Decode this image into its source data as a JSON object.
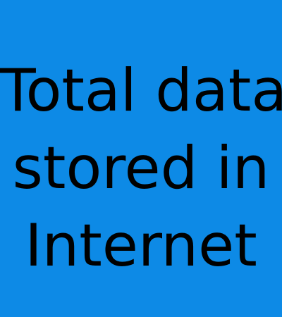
{
  "slide": {
    "background_color": "#0d8ae6",
    "text_color": "#000000",
    "headline_lines": [
      "Total data",
      "stored in",
      "Internet"
    ]
  }
}
